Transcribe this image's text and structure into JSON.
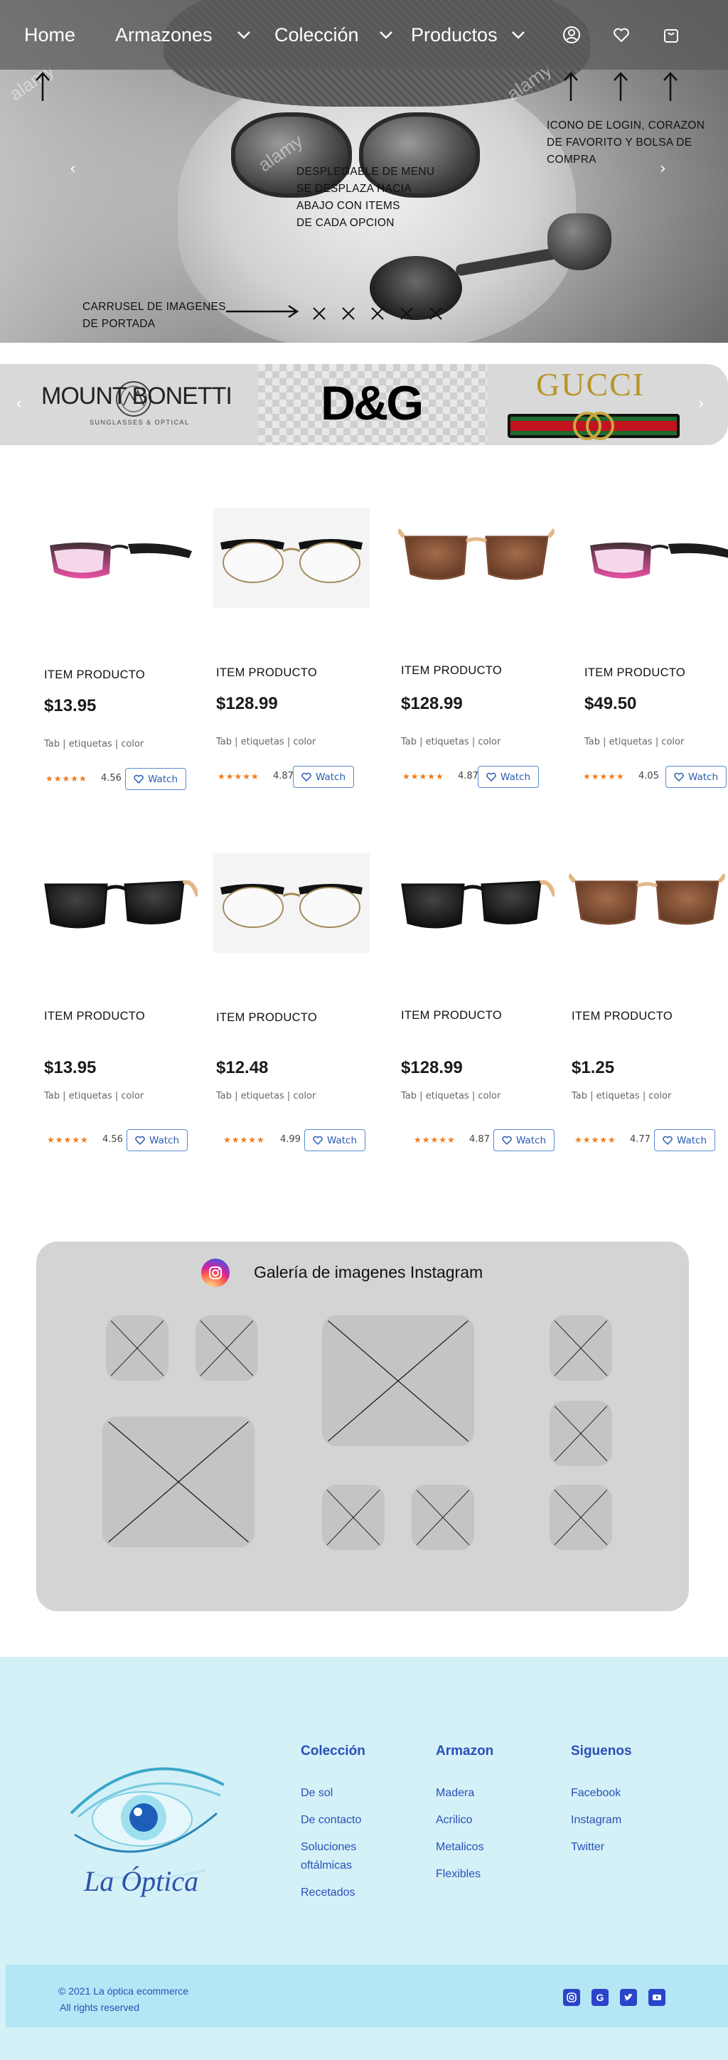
{
  "nav": {
    "items": [
      {
        "label": "Home"
      },
      {
        "label": "Armazones"
      },
      {
        "label": "Colección"
      },
      {
        "label": "Productos"
      }
    ],
    "icons": [
      "user-circle-icon",
      "heart-icon",
      "shopping-bag-icon"
    ]
  },
  "hero": {
    "annotations": {
      "menu_note": "DESPLEGABLE DE MENU\nSE DESPLAZA HACIA\nABAJO CON ITEMS\nDE CADA OPCION",
      "icons_note": "ICONO DE LOGIN, CORAZON\nDE FAVORITO Y BOLSA DE\nCOMPRA",
      "carousel_note": "CARRUSEL DE IMAGENES\nDE PORTADA"
    },
    "watermark": "alamy"
  },
  "brands": {
    "items": [
      {
        "name": "MOUNT BONETTI",
        "tagline": "SUNGLASSES & OPTICAL"
      },
      {
        "name": "D&G"
      },
      {
        "name": "GUCCI"
      }
    ]
  },
  "products": [
    {
      "name": "ITEM PRODUCTO",
      "price": "$13.95",
      "tags": "Tab | etiquetas | color",
      "stars": "★★★★★",
      "rating": "4.56",
      "watch": "Watch",
      "style": "pink-frame"
    },
    {
      "name": "ITEM PRODUCTO",
      "price": "$128.99",
      "tags": "Tab | etiquetas | color",
      "stars": "★★★★★",
      "rating": "4.87",
      "watch": "Watch",
      "style": "browline-clear"
    },
    {
      "name": "ITEM PRODUCTO",
      "price": "$128.99",
      "tags": "Tab | etiquetas | color",
      "stars": "★★★★★",
      "rating": "4.87",
      "watch": "Watch",
      "style": "brown-sun"
    },
    {
      "name": "ITEM PRODUCTO",
      "price": "$49.50",
      "tags": "Tab | etiquetas | color",
      "stars": "★★★★★",
      "rating": "4.05",
      "watch": "Watch",
      "style": "pink-frame"
    },
    {
      "name": "ITEM PRODUCTO",
      "price": "$13.95",
      "tags": "Tab | etiquetas | color",
      "stars": "★★★★★",
      "rating": "4.56",
      "watch": "Watch",
      "style": "black-sun"
    },
    {
      "name": "ITEM PRODUCTO",
      "price": "$12.48",
      "tags": "Tab | etiquetas | color",
      "stars": "★★★★★",
      "rating": "4.99",
      "watch": "Watch",
      "style": "browline-clear"
    },
    {
      "name": "ITEM PRODUCTO",
      "price": "$128.99",
      "tags": "Tab | etiquetas | color",
      "stars": "★★★★★",
      "rating": "4.87",
      "watch": "Watch",
      "style": "black-sun"
    },
    {
      "name": "ITEM PRODUCTO",
      "price": "$1.25",
      "tags": "Tab | etiquetas | color",
      "stars": "★★★★★",
      "rating": "4.77",
      "watch": "Watch",
      "style": "brown-sun"
    }
  ],
  "instagram": {
    "title": "Galería de imagenes Instagram"
  },
  "footer": {
    "logo_text": "La Óptica",
    "columns": [
      {
        "title": "Colección",
        "links": [
          "De sol",
          "De contacto",
          "Soluciones oftálmicas",
          "Recetados"
        ]
      },
      {
        "title": "Armazon",
        "links": [
          "Madera",
          "Acrilico",
          "Metalicos",
          "Flexibles"
        ]
      },
      {
        "title": "Siguenos",
        "links": [
          "Facebook",
          "Instagram",
          "Twitter"
        ]
      }
    ],
    "copyright": "© 2021 La óptica ecommerce",
    "rights": "All rights reserved",
    "social_icons": [
      "instagram-icon",
      "google-icon",
      "twitter-icon",
      "youtube-icon"
    ]
  },
  "colors": {
    "accent": "#2b4fb8",
    "footer_bg": "#d4f1f8",
    "footer_bottom_bg": "#b5e6f5",
    "star": "#f27a1a",
    "watch_border": "#5a8bd6"
  }
}
